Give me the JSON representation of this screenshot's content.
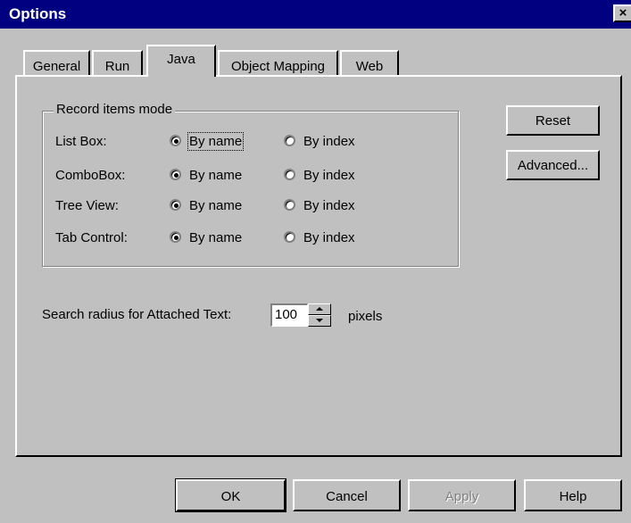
{
  "window": {
    "title": "Options",
    "close_glyph": "×"
  },
  "tabs": [
    {
      "label": "General"
    },
    {
      "label": "Run"
    },
    {
      "label": "Java",
      "active": true
    },
    {
      "label": "Object Mapping"
    },
    {
      "label": "Web"
    }
  ],
  "record_group": {
    "title": "Record items mode",
    "rows": [
      {
        "label": "List Box:",
        "option1": "By name",
        "option2": "By index",
        "selected": "By name"
      },
      {
        "label": "ComboBox:",
        "option1": "By name",
        "option2": "By index",
        "selected": "By name"
      },
      {
        "label": "Tree View:",
        "option1": "By name",
        "option2": "By index",
        "selected": "By name"
      },
      {
        "label": "Tab Control:",
        "option1": "By name",
        "option2": "By index",
        "selected": "By name"
      }
    ]
  },
  "side_buttons": {
    "reset": "Reset",
    "advanced": "Advanced..."
  },
  "search_radius": {
    "label": "Search radius for Attached Text:",
    "value": "100",
    "unit": "pixels"
  },
  "footer": {
    "ok": "OK",
    "cancel": "Cancel",
    "apply": "Apply",
    "help": "Help"
  },
  "colors": {
    "titlebar": "#000080",
    "face": "#c0c0c0"
  }
}
